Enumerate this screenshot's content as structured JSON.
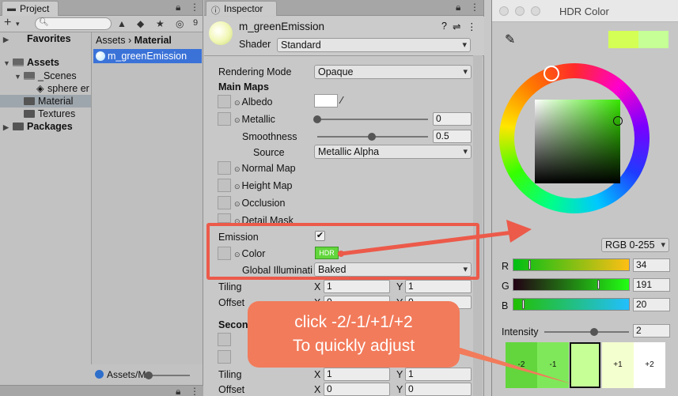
{
  "project": {
    "tab_label": "Project",
    "hidden_count": "9",
    "tree": [
      {
        "label": "Favorites"
      },
      {
        "label": "Assets"
      },
      {
        "label": "_Scenes"
      },
      {
        "label": "sphere er"
      },
      {
        "label": "Material"
      },
      {
        "label": "Textures"
      },
      {
        "label": "Packages"
      }
    ],
    "breadcrumb_root": "Assets",
    "breadcrumb_sep": "›",
    "breadcrumb_current": "Material",
    "selected_asset": "m_greenEmission",
    "bottom_path": "Assets/M"
  },
  "inspector": {
    "tab_label": "Inspector",
    "material_name": "m_greenEmission",
    "shader_label": "Shader",
    "shader_value": "Standard",
    "rendering_mode_label": "Rendering Mode",
    "rendering_mode_value": "Opaque",
    "main_maps_label": "Main Maps",
    "albedo_label": "Albedo",
    "metallic_label": "Metallic",
    "metallic_value": "0",
    "smoothness_label": "Smoothness",
    "smoothness_value": "0.5",
    "source_label": "Source",
    "source_value": "Metallic Alpha",
    "normal_map_label": "Normal Map",
    "height_map_label": "Height Map",
    "occlusion_label": "Occlusion",
    "detail_mask_label": "Detail Mask",
    "emission_label": "Emission",
    "color_label": "Color",
    "hdr_badge": "HDR",
    "gi_label": "Global Illuminati",
    "gi_value": "Baked",
    "tiling_label": "Tiling",
    "tiling_x": "1",
    "tiling_y": "1",
    "offset_label": "Offset",
    "offset_x": "0",
    "offset_y": "0",
    "secondary_label": "Secon",
    "x_label": "X",
    "y_label": "Y"
  },
  "hdr_color": {
    "title": "HDR Color",
    "mode": "RGB 0-255",
    "r_label": "R",
    "r_value": "34",
    "r_fraction": 0.133,
    "g_label": "G",
    "g_value": "191",
    "g_fraction": 0.749,
    "b_label": "B",
    "b_value": "20",
    "b_fraction": 0.078,
    "intensity_label": "Intensity",
    "intensity_value": "2",
    "presets": [
      "-2",
      "-1",
      "",
      "+1",
      "+2"
    ]
  },
  "annotation": {
    "line1": "click -2/-1/+1/+2",
    "line2": "To quickly adjust"
  },
  "colors": {
    "emission_green": "#62d63c",
    "current_color": "#c5ff96",
    "annotation_red": "#ec5a4a",
    "callout_fill": "#f27b5b",
    "selection_blue": "#3a72d8"
  }
}
